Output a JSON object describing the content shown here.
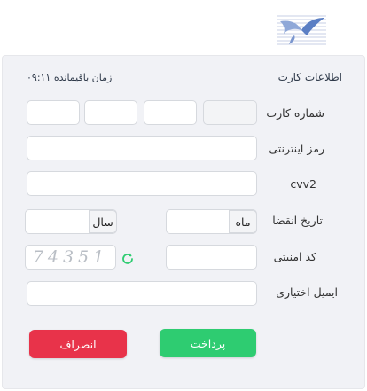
{
  "header": {
    "logo_icon": "bank-logo-icon"
  },
  "card_info": {
    "title": "اطلاعات کارت",
    "timer": "زمان باقیمانده ۰۹:۱۱"
  },
  "fields": {
    "card_number_label": "شماره کارت",
    "internet_password_label": "رمز اینترنتی",
    "cvv2_label": "cvv2",
    "expiry_label": "تاریخ انقضا",
    "month_addon": "ماه",
    "year_addon": "سال",
    "security_code_label": "کد امنیتی",
    "captcha_text": "74351",
    "refresh_icon": "refresh-icon",
    "optional_email_label": "ایمیل اختیاری"
  },
  "buttons": {
    "pay": "پرداخت",
    "cancel": "انصراف"
  },
  "colors": {
    "pay": "#2ecc71",
    "cancel": "#e8334a",
    "refresh": "#2ecc71",
    "panel": "#f1f2f6"
  }
}
